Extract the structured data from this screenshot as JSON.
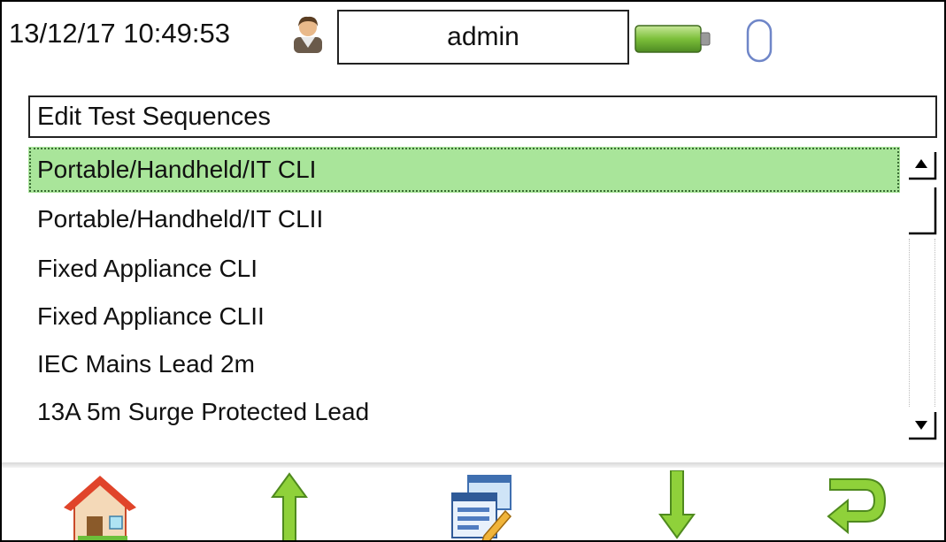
{
  "header": {
    "datetime": "13/12/17 10:49:53",
    "user": "admin",
    "icons": [
      "user-avatar-icon",
      "battery-icon",
      "usb-icon"
    ]
  },
  "list": {
    "title": "Edit Test Sequences",
    "items": [
      "Portable/Handheld/IT CLI",
      "Portable/Handheld/IT CLII",
      "Fixed Appliance CLI",
      "Fixed Appliance CLII",
      "IEC Mains Lead 2m",
      "13A 5m Surge Protected Lead"
    ],
    "selected_index": 0
  },
  "toolbar": {
    "buttons": [
      "home-icon",
      "move-up-icon",
      "edit-sequence-icon",
      "move-down-icon",
      "return-icon"
    ]
  },
  "colors": {
    "selection": "#a9e59a",
    "arrow_green": "#8fd13a",
    "battery_green": "#7cbf3a"
  }
}
